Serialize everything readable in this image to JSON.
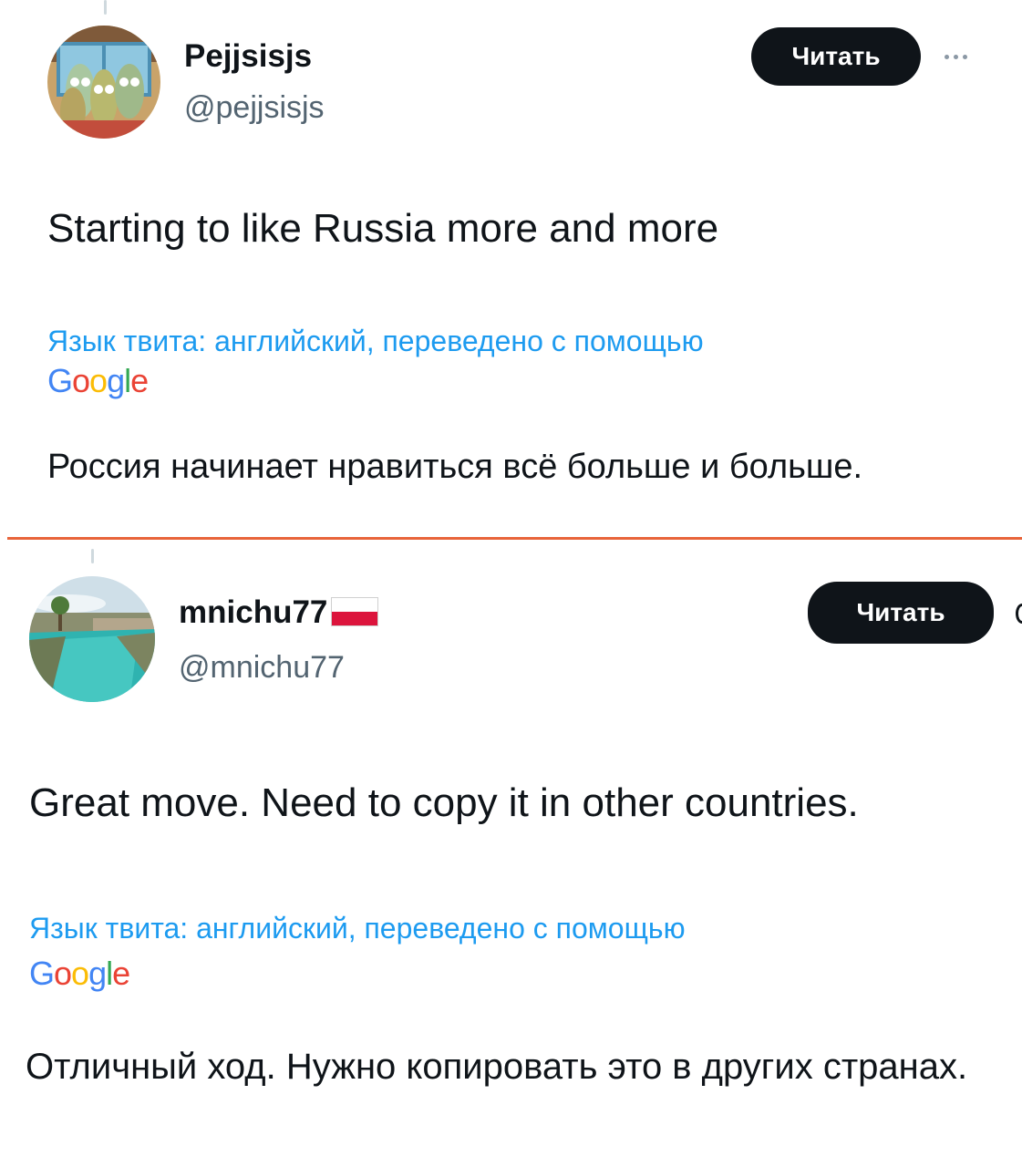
{
  "colors": {
    "text": "#0f1419",
    "secondary": "#536471",
    "link": "#1d9bf0",
    "button_bg": "#0f1419",
    "button_text": "#ffffff",
    "divider": "#e8643a"
  },
  "tweets": [
    {
      "author": {
        "name": "Pejjsisjs",
        "handle": "@pejjsisjs",
        "flag": ""
      },
      "follow_label": "Читать",
      "more_icon": "more-horizontal-icon",
      "text": "Starting to like Russia more and more",
      "translation_note": "Язык твита: английский, переведено с помощью",
      "translator": "Google",
      "translated_text": "Россия начинает нравиться всё больше и больше."
    },
    {
      "author": {
        "name": "mnichu77",
        "handle": "@mnichu77",
        "flag": "poland-flag"
      },
      "follow_label": "Читать",
      "text": "Great move. Need to copy it in other countries.",
      "translation_note": "Язык твита: английский, переведено с помощью",
      "translator": "Google",
      "translated_text": "Отличный ход. Нужно копировать это в других странах."
    }
  ]
}
